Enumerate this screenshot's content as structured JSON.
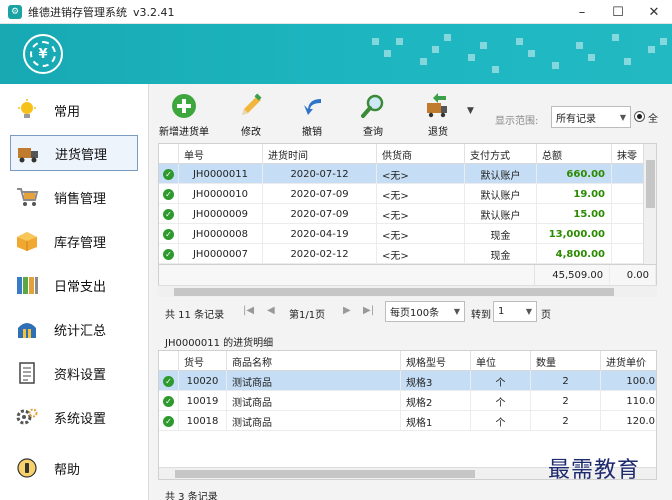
{
  "window": {
    "title": "维德进销存管理系统",
    "version": "v3.2.41",
    "min_icon": "minimize-icon",
    "max_icon": "maximize-icon",
    "close_icon": "close-icon"
  },
  "colors": {
    "banner": "#1db6c0",
    "selected_row": "#c5def5",
    "amount_green": "#2a8a00",
    "check_green": "#2e9a2e"
  },
  "sidebar": {
    "items": [
      {
        "label": "常用",
        "icon": "lightbulb-icon"
      },
      {
        "label": "进货管理",
        "icon": "truck-icon",
        "active": true
      },
      {
        "label": "销售管理",
        "icon": "cart-icon"
      },
      {
        "label": "库存管理",
        "icon": "box-icon"
      },
      {
        "label": "日常支出",
        "icon": "binder-icon"
      },
      {
        "label": "统计汇总",
        "icon": "building-icon"
      },
      {
        "label": "资料设置",
        "icon": "document-icon"
      },
      {
        "label": "系统设置",
        "icon": "gear-icon"
      },
      {
        "label": "帮助",
        "icon": "help-icon"
      }
    ]
  },
  "toolbar": {
    "new_label": "新增进货单",
    "edit_label": "修改",
    "undo_label": "撤销",
    "query_label": "查询",
    "return_label": "退货",
    "range_label": "显示范围:",
    "range_value": "所有记录",
    "radio_label": "全"
  },
  "orders": {
    "columns": [
      "单号",
      "进货时间",
      "供货商",
      "支付方式",
      "总额",
      "抹零"
    ],
    "rows": [
      {
        "id": "JH0000011",
        "date": "2020-07-12",
        "supplier": "<无>",
        "pay": "默认账户",
        "total": "660.00"
      },
      {
        "id": "JH0000010",
        "date": "2020-07-09",
        "supplier": "<无>",
        "pay": "默认账户",
        "total": "19.00"
      },
      {
        "id": "JH0000009",
        "date": "2020-07-09",
        "supplier": "<无>",
        "pay": "默认账户",
        "total": "15.00"
      },
      {
        "id": "JH0000008",
        "date": "2020-04-19",
        "supplier": "<无>",
        "pay": "现金",
        "total": "13,000.00"
      },
      {
        "id": "JH0000007",
        "date": "2020-02-12",
        "supplier": "<无>",
        "pay": "现金",
        "total": "4,800.00"
      }
    ],
    "sum_total": "45,509.00",
    "sum_round": "0.00"
  },
  "pager": {
    "count": "共 11 条记录",
    "page": "第1/1页",
    "per_page": "每页100条",
    "goto_label": "转到",
    "goto_value": "1",
    "page_suffix": "页"
  },
  "detail": {
    "title": "JH0000011 的进货明细",
    "columns": [
      "货号",
      "商品名称",
      "规格型号",
      "单位",
      "数量",
      "进货单价"
    ],
    "rows": [
      {
        "code": "10020",
        "name": "测试商品",
        "spec": "规格3",
        "unit": "个",
        "qty": "2",
        "price": "100.0"
      },
      {
        "code": "10019",
        "name": "测试商品",
        "spec": "规格2",
        "unit": "个",
        "qty": "2",
        "price": "110.0"
      },
      {
        "code": "10018",
        "name": "测试商品",
        "spec": "规格1",
        "unit": "个",
        "qty": "2",
        "price": "120.0"
      }
    ],
    "count": "共 3 条记录"
  },
  "watermark": "最需教育"
}
